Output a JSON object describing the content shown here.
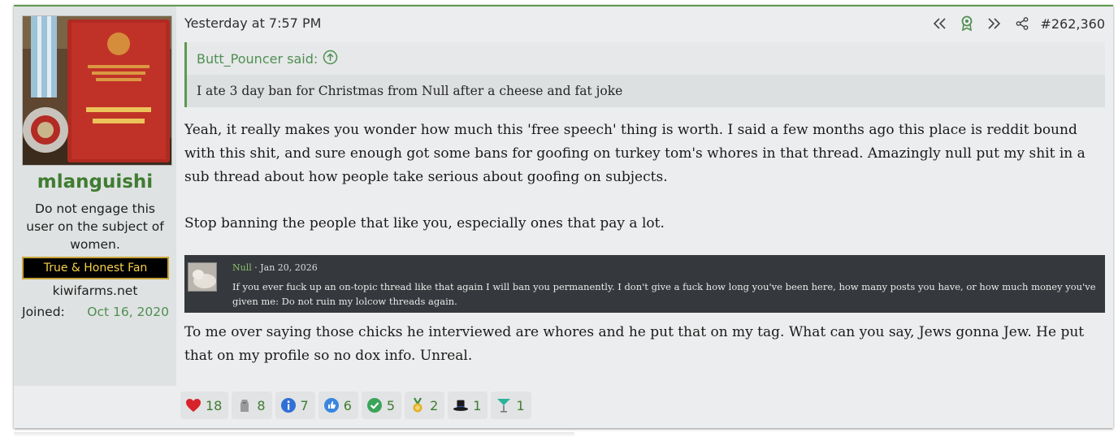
{
  "user": {
    "username": "mlanguishi",
    "title": "Do not engage this user on the subject of women.",
    "banner": "True & Honest Fan",
    "website": "kiwifarms.net",
    "joined_label": "Joined:",
    "joined_date": "Oct 16, 2020"
  },
  "post": {
    "timestamp": "Yesterday at 7:57 PM",
    "number": "#262,360",
    "quote": {
      "author": "Butt_Pouncer said:",
      "text": "I ate 3 day ban for Christmas from Null after a cheese and fat joke"
    },
    "paragraphs": [
      "Yeah, it really makes you wonder how much this 'free speech' thing is worth. I said a few months ago this place is reddit bound with this shit, and sure enough got some bans for goofing on turkey tom's whores in that thread. Amazingly null put my shit in a sub thread about how people take serious about goofing on subjects.",
      "Stop banning the people that like you, especially ones that pay a lot.",
      "To me over saying those chicks he interviewed are whores and he put that on my tag. What can you say, Jews gonna Jew. He put that on my profile so no dox info. Unreal."
    ],
    "embed": {
      "author": "Null",
      "date": " · Jan 20, 2026",
      "text": "If you ever fuck up an on-topic thread like that again I will ban you permanently. I don't give a fuck how long you've been here, how many posts you have, or how much money you've given me: Do not ruin my lolcow threads again."
    }
  },
  "reactions": [
    {
      "icon": "heart-icon",
      "count": "18",
      "color": "#d8232a"
    },
    {
      "icon": "stone-icon",
      "count": "8",
      "color": "#8a8a8a"
    },
    {
      "icon": "info-icon",
      "count": "7",
      "color": "#2f6fd6"
    },
    {
      "icon": "thumbs-up-icon",
      "count": "6",
      "color": "#3a86e0"
    },
    {
      "icon": "checkmark-icon",
      "count": "5",
      "color": "#3aa45a"
    },
    {
      "icon": "medal-icon",
      "count": "2",
      "color": "#e2b02a"
    },
    {
      "icon": "top-hat-icon",
      "count": "1",
      "color": "#1a1a1a"
    },
    {
      "icon": "cocktail-icon",
      "count": "1",
      "color": "#2bb39b"
    }
  ],
  "colors": {
    "accent": "#5c9a4e",
    "link": "#4f8f52"
  }
}
